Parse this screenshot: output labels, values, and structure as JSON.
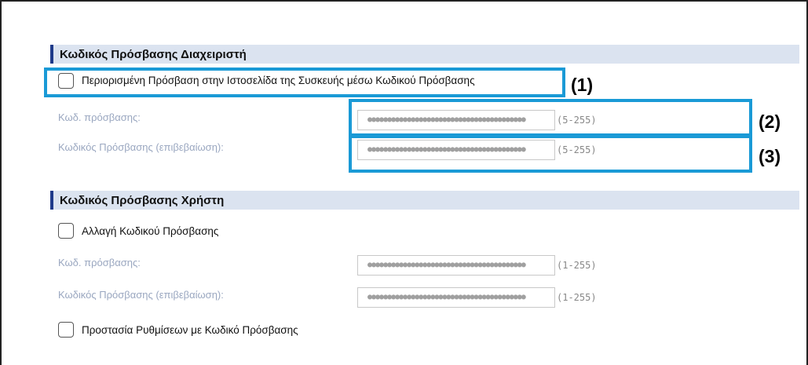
{
  "admin_section": {
    "title": "Κωδικός Πρόσβασης Διαχειριστή",
    "restrict_label": "Περιορισμένη Πρόσβαση στην Ιστοσελίδα της  Συσκευής μέσω Κωδικού Πρόσβασης",
    "password_label": "Κωδ. πρόσβασης:",
    "password_value": "●●●●●●●●●●●●●●●●●●●●●●●●●●●●●●●●●●●●●●●●",
    "password_range": "(5-255)",
    "confirm_label": "Κωδικός Πρόσβασης (επιβεβαίωση):",
    "confirm_value": "●●●●●●●●●●●●●●●●●●●●●●●●●●●●●●●●●●●●●●●●",
    "confirm_range": "(5-255)"
  },
  "user_section": {
    "title": "Κωδικός Πρόσβασης Χρήστη",
    "change_label": "Αλλαγή Κωδικού Πρόσβασης",
    "password_label": "Κωδ. πρόσβασης:",
    "password_value": "●●●●●●●●●●●●●●●●●●●●●●●●●●●●●●●●●●●●●●●●",
    "password_range": "(1-255)",
    "confirm_label": "Κωδικός Πρόσβασης (επιβεβαίωση):",
    "confirm_value": "●●●●●●●●●●●●●●●●●●●●●●●●●●●●●●●●●●●●●●●●",
    "confirm_range": "(1-255)",
    "protect_label": "Προστασία Ρυθμίσεων με Κωδικό Πρόσβασης"
  },
  "callouts": [
    "(1)",
    "(2)",
    "(3)"
  ],
  "colors": {
    "highlight": "#1a9ad6",
    "header_bg": "#dbe3f0",
    "header_bar": "#1e3a8a",
    "muted_label": "#9aa7c0"
  }
}
